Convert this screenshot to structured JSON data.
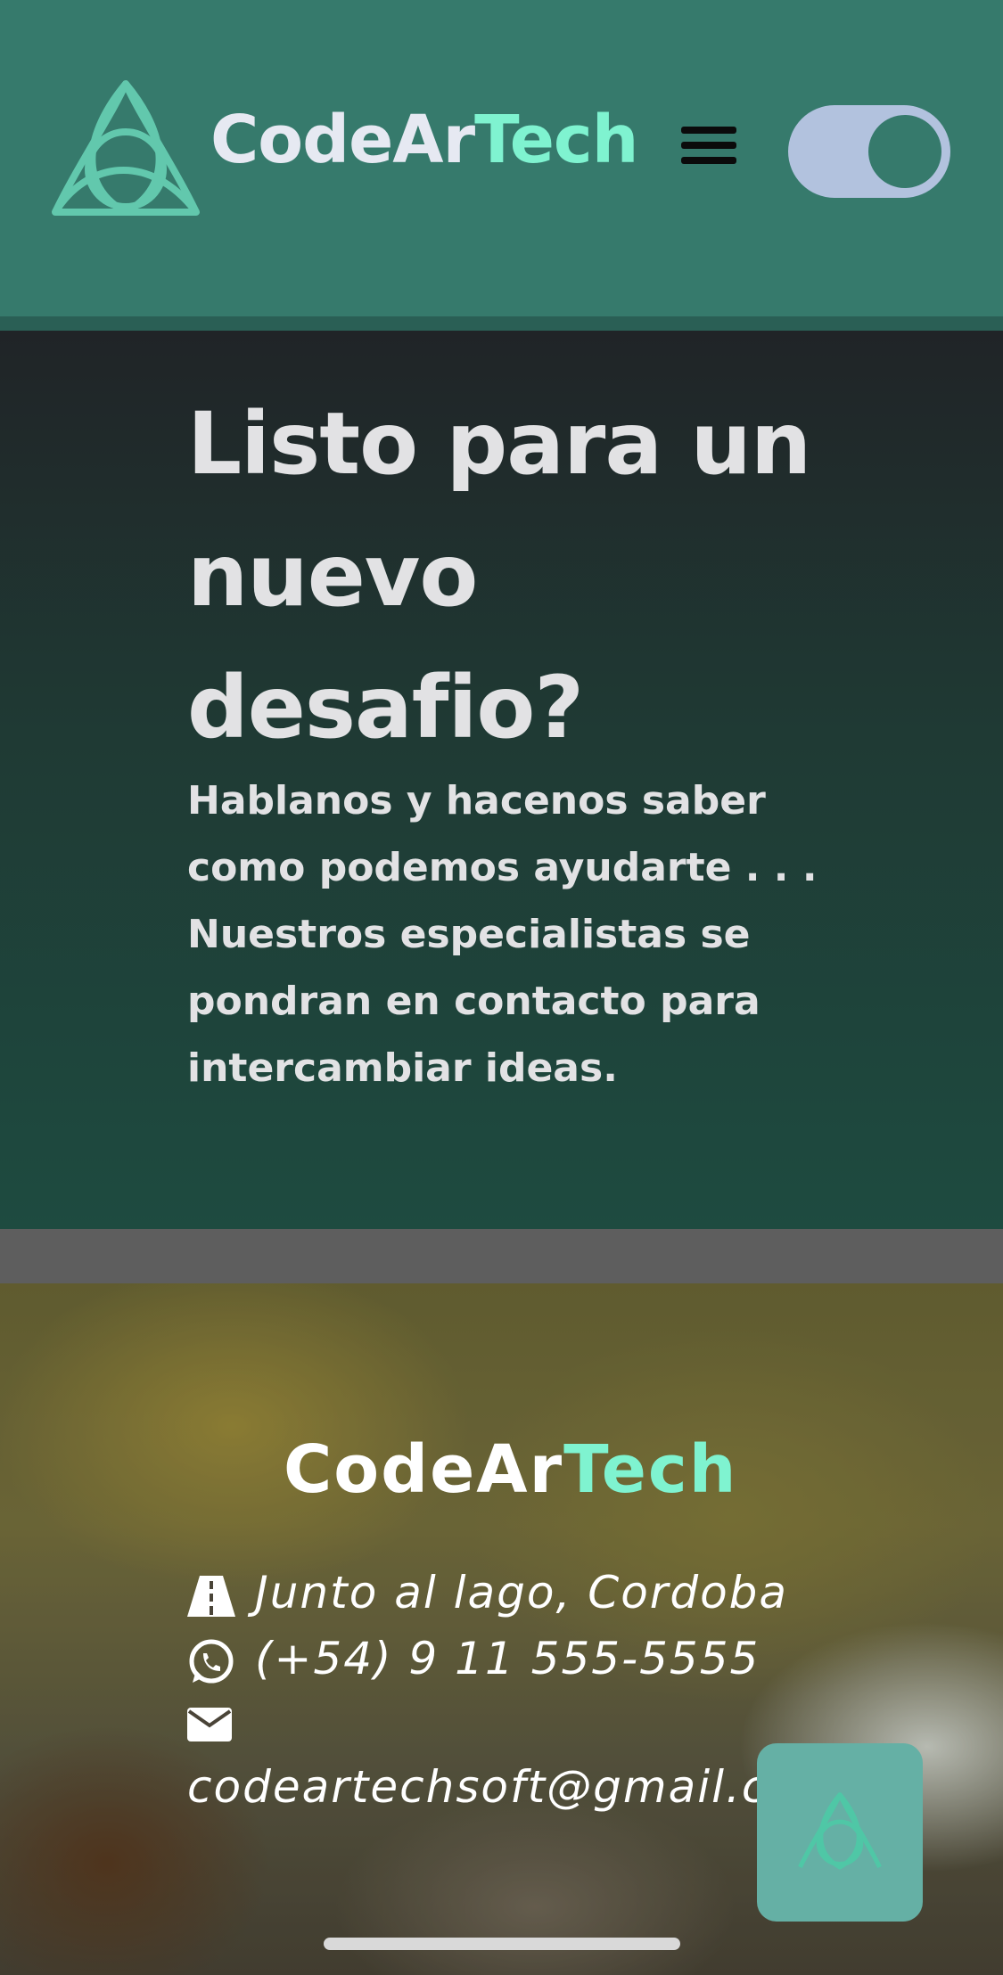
{
  "header": {
    "brand_main": "CodeAr",
    "brand_accent": "Tech",
    "menu_icon": "hamburger-menu-icon",
    "theme_toggle_icon": "toggle-switch"
  },
  "hero": {
    "title": "Listo para un nuevo desafio?",
    "subtitle": "Hablanos y hacenos saber como podemos ayudarte . . . Nuestros especialistas se pondran en contacto para intercambiar ideas."
  },
  "footer": {
    "brand_main": "CodeAr",
    "brand_accent": "Tech",
    "address": "Junto al lago, Cordoba",
    "phone": "(+54) 9 11 555-5555",
    "email": "codeartechsoft@gmail.c",
    "address_icon": "road-icon",
    "phone_icon": "whatsapp-icon",
    "email_icon": "envelope-icon"
  },
  "floating_button": {
    "icon": "triquetra-logo-icon"
  },
  "colors": {
    "header_bg": "#367a6c",
    "accent": "#7ff3d0",
    "toggle_bg": "#b2c2de",
    "floating_btn": "#65b0a5"
  }
}
